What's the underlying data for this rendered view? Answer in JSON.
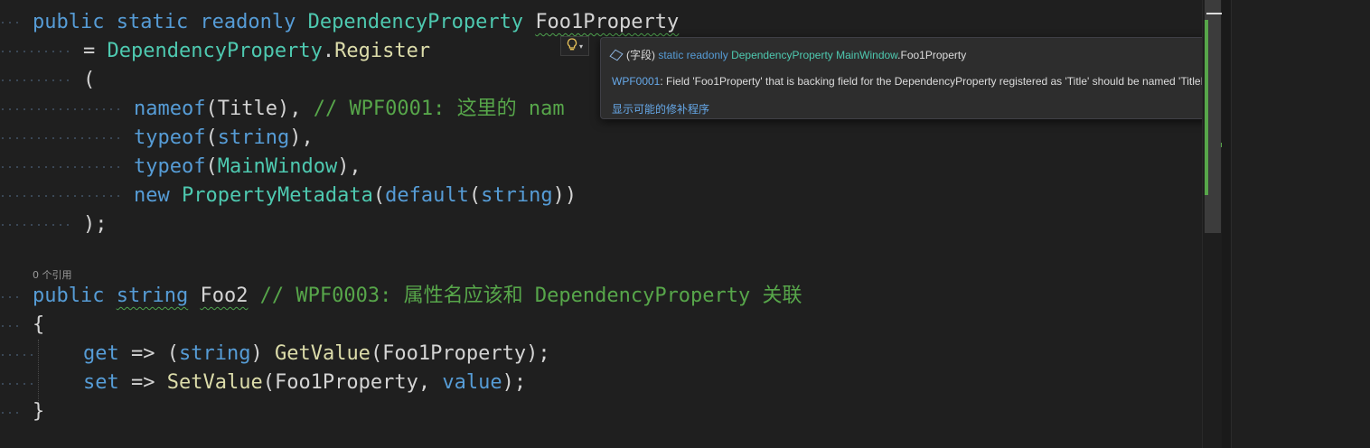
{
  "code": {
    "line1": {
      "kw": "public static readonly ",
      "type": "DependencyProperty",
      "name": "Foo1Property"
    },
    "line2": {
      "eq": "= ",
      "type": "DependencyProperty",
      "dot": ".",
      "method": "Register"
    },
    "line3": {
      "text": "("
    },
    "line4": {
      "kw": "nameof",
      "p1": "(Title), ",
      "comment": "// WPF0001: 这里的 nam"
    },
    "line5": {
      "kw1": "typeof",
      "p1": "(",
      "kw2": "string",
      "p2": "),"
    },
    "line6": {
      "kw": "typeof",
      "p1": "(",
      "type": "MainWindow",
      "p2": "),"
    },
    "line7": {
      "kw1": "new ",
      "type": "PropertyMetadata",
      "p1": "(",
      "kw2": "default",
      "p2": "(",
      "kw3": "string",
      "p3": "))"
    },
    "line8": {
      "text": ");"
    },
    "codelens": "0 个引用",
    "line9": {
      "kw1": "public ",
      "kw2": "string",
      "space": " ",
      "name": "Foo2",
      "comment": " // WPF0003: 属性名应该和 DependencyProperty 关联"
    },
    "line10": {
      "text": "{"
    },
    "line11": {
      "kw1": "get",
      "arrow": " => (",
      "kw2": "string",
      "p1": ") ",
      "method": "GetValue",
      "p2": "(Foo1Property);"
    },
    "line12": {
      "kw1": "set",
      "arrow": " => ",
      "method": "SetValue",
      "p1": "(Foo1Property, ",
      "kw2": "value",
      "p2": ");"
    },
    "line13": {
      "text": "}"
    }
  },
  "lightbulb": {
    "icon": "lightbulb-icon",
    "caret": "▾"
  },
  "tooltip": {
    "field_icon": "field-cube-icon",
    "kind": "(字段)",
    "modifiers": "static readonly",
    "type": "DependencyProperty",
    "class": "MainWindow",
    "member": ".Foo1Property",
    "diag_code": "WPF0001",
    "diag_message": ": Field 'Foo1Property' that is backing field for the DependencyProperty registered as 'Title' should be named 'TitleProperty'",
    "fix_link": "显示可能的修补程序"
  },
  "colors": {
    "background": "#1f1f1f",
    "keyword": "#569cd6",
    "type": "#4ec9b0",
    "method": "#dcdcaa",
    "comment": "#57a64a",
    "link": "#66a8e8"
  }
}
